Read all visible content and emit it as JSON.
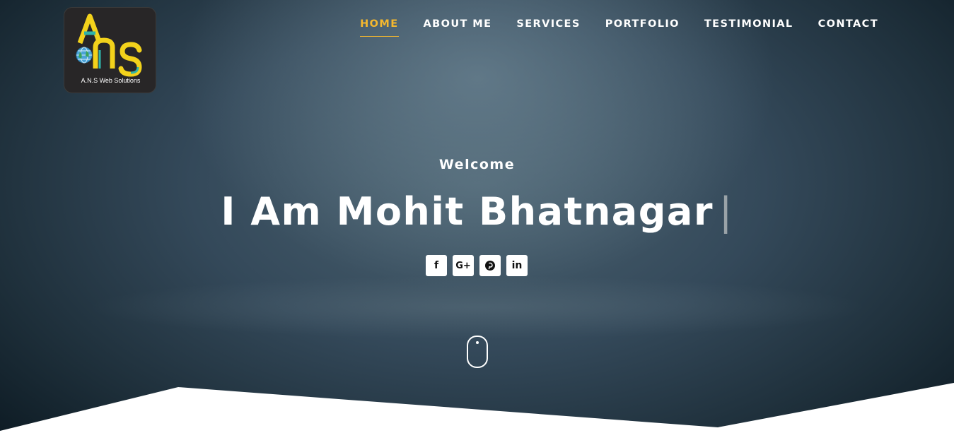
{
  "brand": {
    "logo_caption": "A.N.S Web Solutions",
    "colors": {
      "yellow": "#f3d21b",
      "teal": "#2fb3a9",
      "globe": "#4aa3d8"
    }
  },
  "nav": {
    "items": [
      {
        "label": "HOME",
        "active": true
      },
      {
        "label": "ABOUT ME",
        "active": false
      },
      {
        "label": "SERVICES",
        "active": false
      },
      {
        "label": "PORTFOLIO",
        "active": false
      },
      {
        "label": "TESTIMONIAL",
        "active": false
      },
      {
        "label": "CONTACT",
        "active": false
      }
    ],
    "active_color": "#f5b82e"
  },
  "hero": {
    "welcome": "Welcome",
    "headline": "I Am Mohit Bhatnagar",
    "cursor": "|"
  },
  "social": [
    {
      "icon": "facebook-icon",
      "glyph": "f"
    },
    {
      "icon": "google-plus-icon",
      "glyph": "G+"
    },
    {
      "icon": "pinterest-icon",
      "glyph": "℗"
    },
    {
      "icon": "linkedin-icon",
      "glyph": "in"
    }
  ],
  "scroll_indicator": {
    "icon": "mouse-scroll-icon"
  }
}
